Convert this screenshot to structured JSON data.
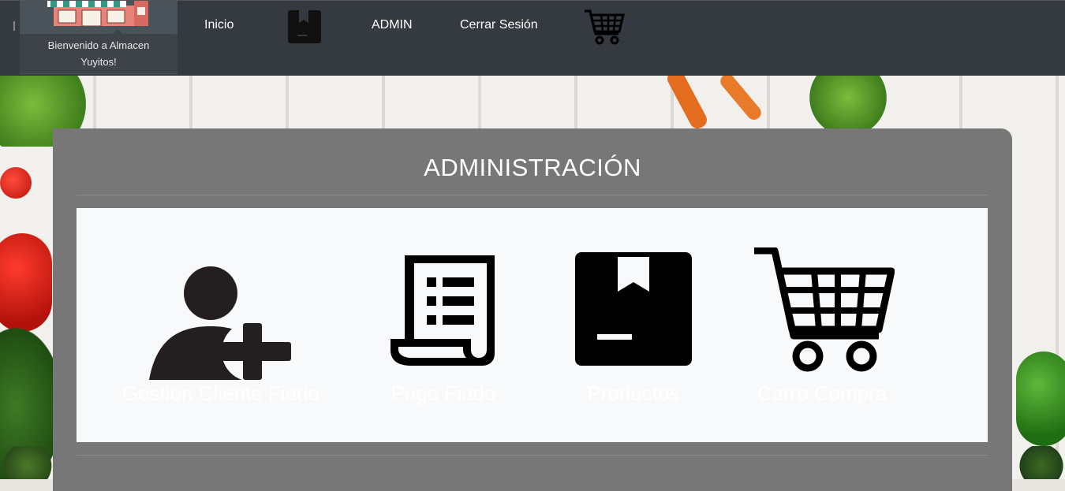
{
  "navbar": {
    "brand_text_line1": "Bienvenido a Almacen",
    "brand_text_line2": "Yuyitos!",
    "links": {
      "inicio": "Inicio",
      "admin": "ADMIN",
      "logout": "Cerrar Sesión"
    },
    "icons": [
      "store-image",
      "package-box-icon",
      "shopping-cart-icon"
    ]
  },
  "main": {
    "title": "ADMINISTRACIÓN",
    "tiles": [
      {
        "label": "Gestion Cliente Fiado",
        "icon": "add-user-icon"
      },
      {
        "label": "Pago Fiado",
        "icon": "receipt-scroll-icon"
      },
      {
        "label": "Productos",
        "icon": "package-box-icon"
      },
      {
        "label": "Carro Compra",
        "icon": "shopping-cart-icon"
      }
    ]
  },
  "colors": {
    "navbar_bg": "#343a40",
    "panel_bg": "#777777",
    "tiles_bg": "#f8f9fa",
    "icon_color": "#000000",
    "label_color": "#ffffff"
  }
}
